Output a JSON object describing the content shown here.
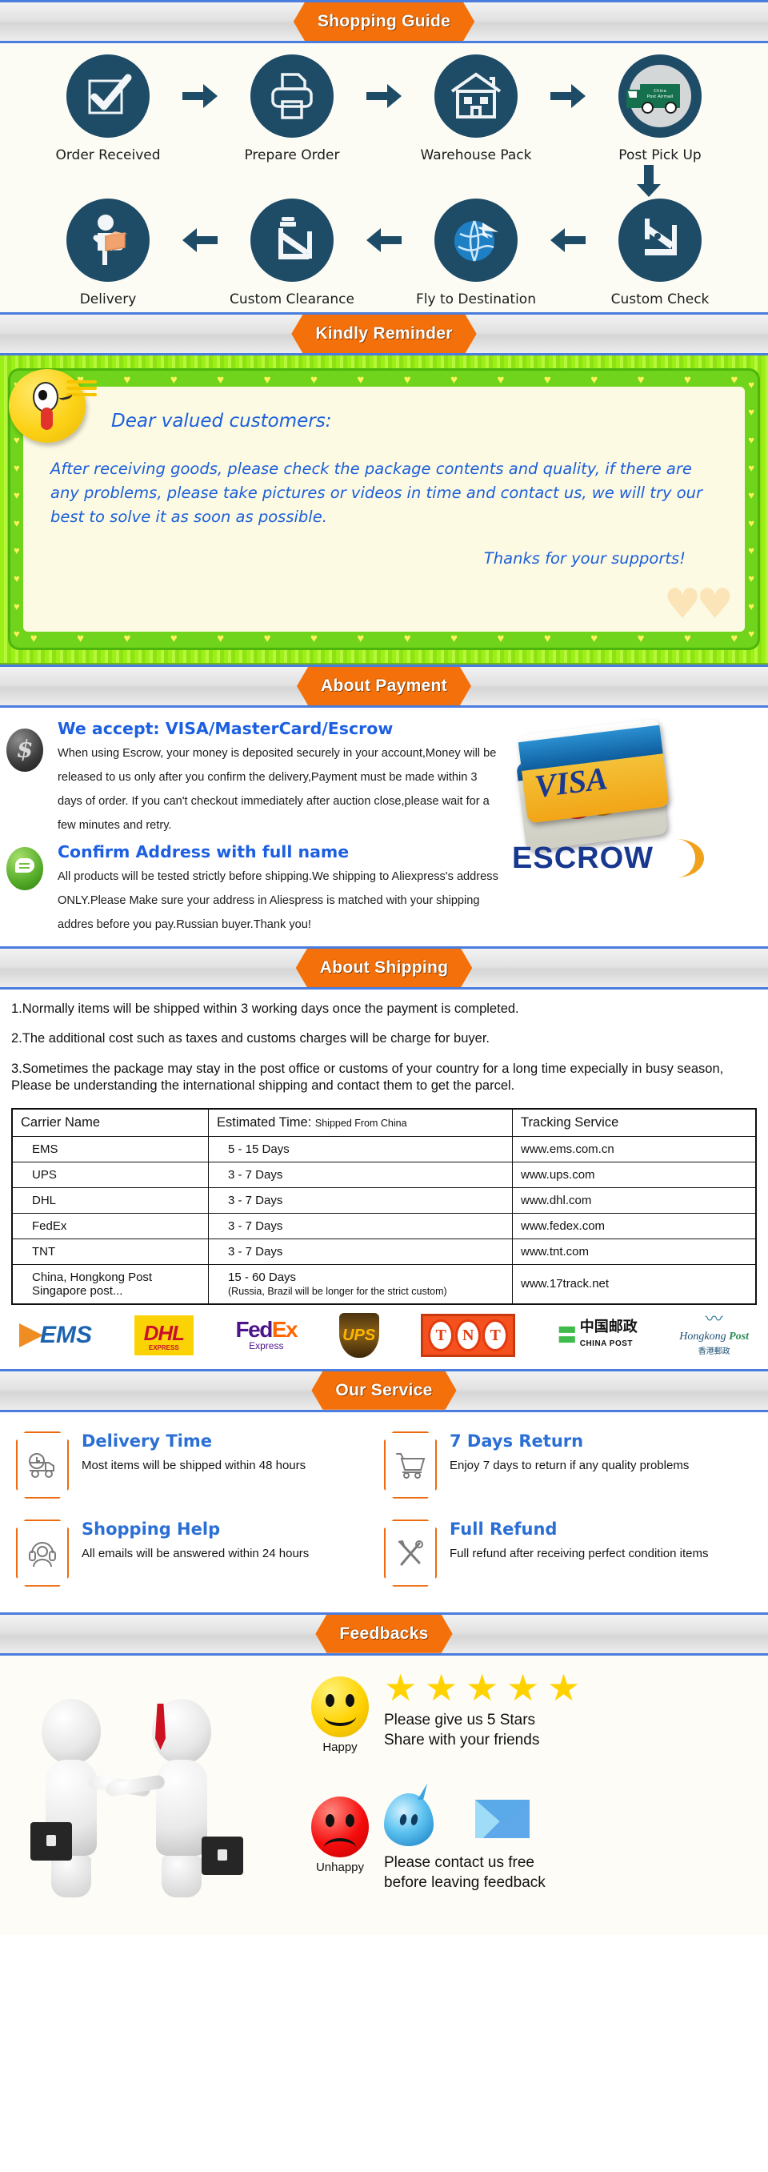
{
  "sections": {
    "shopping_guide": "Shopping Guide",
    "kindly_reminder": "Kindly Reminder",
    "about_payment": "About Payment",
    "about_shipping": "About Shipping",
    "our_service": "Our Service",
    "feedbacks": "Feedbacks"
  },
  "guide": {
    "row1": [
      {
        "label": "Order Received",
        "icon": "checkbox-icon"
      },
      {
        "label": "Prepare Order",
        "icon": "printer-icon"
      },
      {
        "label": "Warehouse Pack",
        "icon": "warehouse-icon"
      },
      {
        "label": "Post Pick Up",
        "icon": "post-truck-icon"
      }
    ],
    "row2": [
      {
        "label": "Delivery",
        "icon": "delivery-man-icon"
      },
      {
        "label": "Custom Clearance",
        "icon": "custom-officer-icon"
      },
      {
        "label": "Fly to Destination",
        "icon": "globe-icon"
      },
      {
        "label": "Custom Check",
        "icon": "custom-check-icon"
      }
    ],
    "truck_text_line1": "China",
    "truck_text_line2": "Post Airmail"
  },
  "reminder": {
    "title": "Dear valued customers:",
    "body1": "After receiving goods, please check the package contents and quality, if there are any problems, please take pictures or videos in time and contact us, we will try our best to solve it as soon as possible.",
    "thanks": "Thanks for your supports!"
  },
  "payment": {
    "heading1": "We accept: VISA/MasterCard/Escrow",
    "body1": "When using Escrow, your money is deposited securely in your account,Money will be released to us only after you confirm the delivery,Payment must be made within 3 days of  order. If you can't checkout immediately after auction close,please wait for a few minutes and retry.",
    "heading2": "Confirm Address with full name",
    "body2": "All products will be tested strictly before shipping.We shipping to Aliexpress's address ONLY.Please Make sure your address in Aliespress is matched with your shipping addres before you pay.Russian buyer.Thank you!",
    "visa_logo": "VISA",
    "escrow_logo": "ESCROW",
    "dollar_symbol": "$"
  },
  "shipping": {
    "notes": [
      "1.Normally items will be shipped within 3 working days once the payment is completed.",
      "2.The additional cost such as taxes and customs charges will be charge for buyer.",
      "3.Sometimes the package may stay in the post office or customs of your country for a long time expecially in busy season, Please be understanding the international shipping and contact them to get the parcel."
    ],
    "table": {
      "headers": {
        "carrier": "Carrier Name",
        "estimated_main": "Estimated Time:",
        "estimated_sub": "Shipped From China",
        "tracking": "Tracking Service"
      },
      "rows": [
        {
          "carrier": "EMS",
          "time": "5 - 15 Days",
          "time_sub": "",
          "tracking": "www.ems.com.cn"
        },
        {
          "carrier": "UPS",
          "time": "3 - 7   Days",
          "time_sub": "",
          "tracking": "www.ups.com"
        },
        {
          "carrier": "DHL",
          "time": "3 - 7   Days",
          "time_sub": "",
          "tracking": "www.dhl.com"
        },
        {
          "carrier": "FedEx",
          "time": "3 - 7   Days",
          "time_sub": "",
          "tracking": "www.fedex.com"
        },
        {
          "carrier": "TNT",
          "time": "3 - 7   Days",
          "time_sub": "",
          "tracking": "www.tnt.com"
        },
        {
          "carrier": "China, Hongkong Post Singapore post...",
          "time": "15 - 60 Days",
          "time_sub": "(Russia, Brazil will be longer for the strict custom)",
          "tracking": "www.17track.net"
        }
      ]
    },
    "logos": {
      "ems": "EMS",
      "dhl": "DHL",
      "dhl_sub": "EXPRESS",
      "fedex_fed": "Fed",
      "fedex_ex": "Ex",
      "fedex_sub": "Express",
      "ups": "UPS",
      "tnt": [
        "T",
        "N",
        "T"
      ],
      "china_post_cn": "中国邮政",
      "china_post_en": "CHINA POST",
      "hk_post_1": "Hongkong",
      "hk_post_2": "Post",
      "hk_post_cn": "香港郵政"
    }
  },
  "service": [
    {
      "title": "Delivery Time",
      "text": "Most items will be shipped within 48 hours",
      "icon": "delivery-truck-icon"
    },
    {
      "title": "7 Days Return",
      "text": "Enjoy 7 days to return if any quality problems",
      "icon": "shopping-cart-icon"
    },
    {
      "title": "Shopping Help",
      "text": "All emails will be answered within 24 hours",
      "icon": "headset-icon"
    },
    {
      "title": "Full Refund",
      "text": "Full refund after receiving perfect condition items",
      "icon": "tools-icon"
    }
  ],
  "feedback": {
    "happy_label": "Happy",
    "unhappy_label": "Unhappy",
    "stars_count": 5,
    "happy_text_1": "Please give us 5 Stars",
    "happy_text_2": "Share with your friends",
    "unhappy_text_1": "Please contact us free",
    "unhappy_text_2": "before leaving feedback"
  },
  "colors": {
    "accent_orange": "#f4700a",
    "header_blue_border": "#4a7ddd",
    "icon_navy": "#1e4b66",
    "link_blue": "#2b6fd4",
    "reminder_green": "#6fd41b",
    "reminder_text_blue": "#1b5fd9"
  }
}
